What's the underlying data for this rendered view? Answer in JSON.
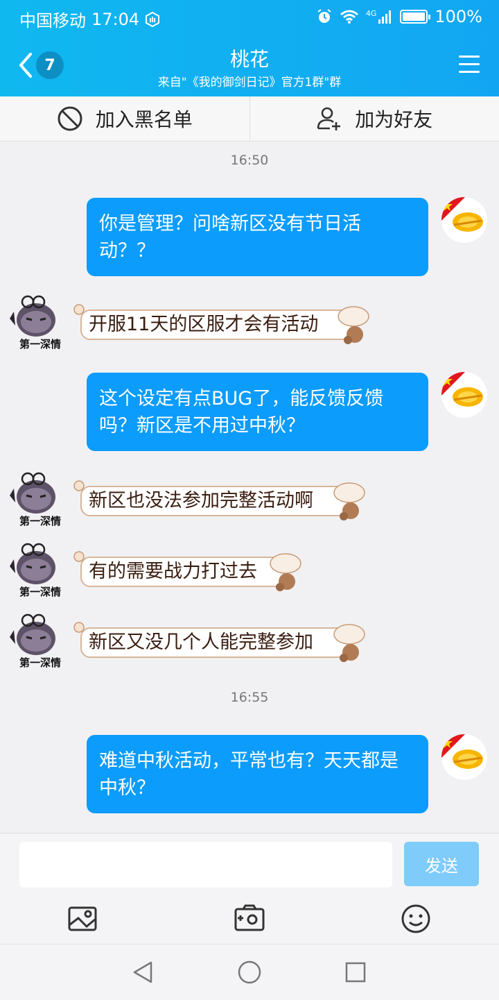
{
  "status_bar": {
    "carrier": "中国移动",
    "time": "17:04",
    "network": "4G",
    "battery": "100%"
  },
  "header": {
    "unread_count": "7",
    "title": "桃花",
    "subtitle": "来自\"《我的御剑日记》官方1群\"群"
  },
  "actions": {
    "block": "加入黑名单",
    "add_friend": "加为好友"
  },
  "messages": {
    "t1": "16:50",
    "m1": "你是管理？问啥新区没有节日活动？？",
    "m2": "开服11天的区服才会有活动",
    "m3": "这个设定有点BUG了，能反馈反馈吗？新区是不用过中秋？",
    "m4": "新区也没法参加完整活动啊",
    "m5": "有的需要战力打过去",
    "m6": "新区又没几个人能完整参加",
    "t2": "16:55",
    "m7": "难道中秋活动，平常也有？天天都是中秋？"
  },
  "avatar_label": "第一深情",
  "composer": {
    "send_label": "发送",
    "input_value": ""
  },
  "colors": {
    "accent": "#12a6f2",
    "outgoing_bubble": "#0c9cfb",
    "send_disabled": "#7fcbfa"
  }
}
